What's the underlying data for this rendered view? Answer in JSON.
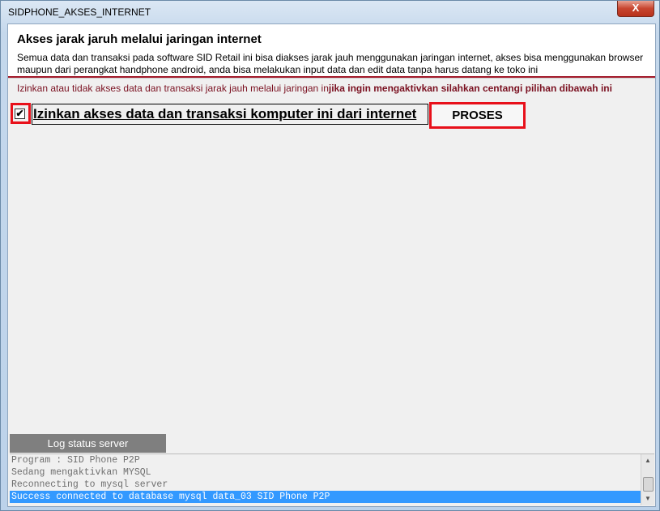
{
  "window": {
    "title": "SIDPHONE_AKSES_INTERNET",
    "close_label": "X"
  },
  "header": {
    "title": "Akses jarak jaruh melalui jaringan internet",
    "description": "Semua data dan transaksi pada software SID Retail ini bisa diakses jarak jauh menggunakan jaringan internet, akses bisa menggunakan browser maupun dari perangkat handphone android, anda bisa melakukan input data dan edit data tanpa harus datang ke toko ini"
  },
  "notice": {
    "normal": "Izinkan atau tidak akses data dan transaksi jarak jauh melalui jaringan in",
    "bold": "jika ingin mengaktivkan silahkan centangi pilihan dibawah ini"
  },
  "access": {
    "checked": true,
    "checkmark": "✔",
    "label": "Izinkan akses data dan transaksi komputer ini dari internet",
    "button_label": "PROSES"
  },
  "log": {
    "tab_label": "Log status server",
    "lines": [
      "Program : SID Phone P2P",
      "Sedang mengaktivkan MYSQL",
      "Reconnecting to mysql server",
      "Success connected to database mysql data_03 SID Phone P2P"
    ],
    "selected_index": 3
  },
  "colors": {
    "highlight": "#e8101a",
    "notice": "#7a1020",
    "selection": "#3399ff"
  }
}
